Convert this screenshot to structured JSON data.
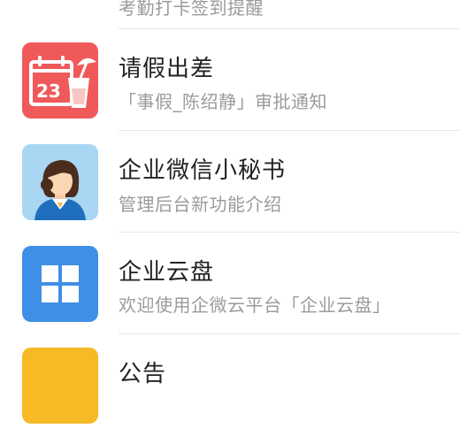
{
  "items": [
    {
      "title": "",
      "subtitle": "考勤打卡签到提醒",
      "icon": "attendance-icon",
      "color": "#2e9e84"
    },
    {
      "title": "请假出差",
      "subtitle": "「事假_陈绍静」审批通知",
      "icon": "calendar-cup-icon",
      "color": "#f0595a",
      "calendar_day": "23"
    },
    {
      "title": "企业微信小秘书",
      "subtitle": "管理后台新功能介绍",
      "icon": "assistant-avatar-icon",
      "color": "#a9d6f3"
    },
    {
      "title": "企业云盘",
      "subtitle": "欢迎使用企微云平台「企业云盘」",
      "icon": "grid-icon",
      "color": "#3f8fe6"
    },
    {
      "title": "公告",
      "subtitle": "",
      "icon": "announcement-icon",
      "color": "#f7b924"
    }
  ]
}
